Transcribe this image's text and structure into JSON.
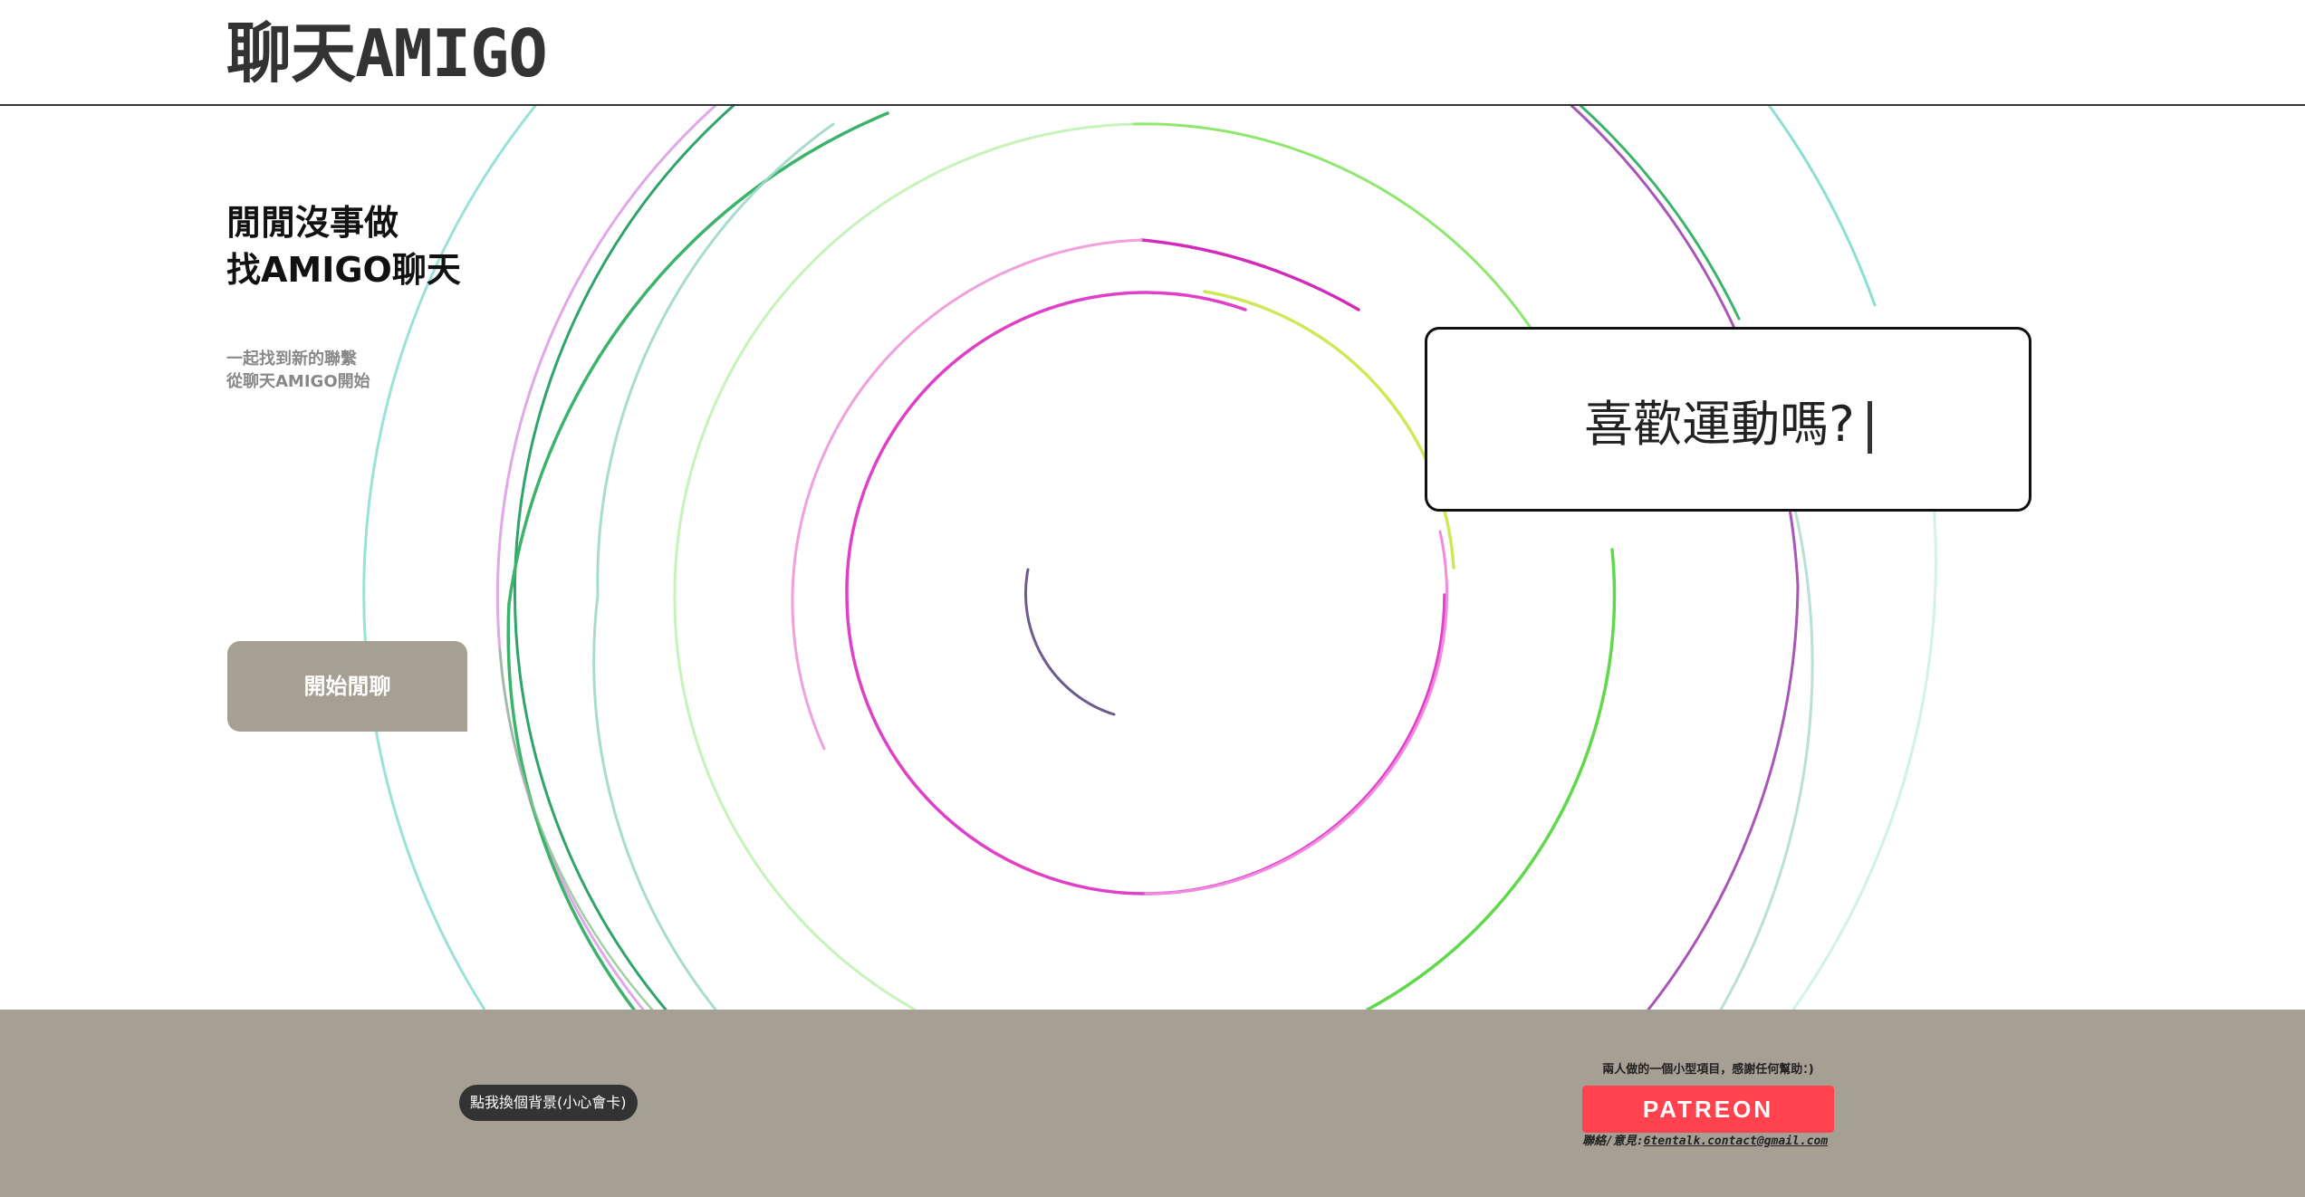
{
  "header": {
    "logo": "聊天AMIGO"
  },
  "hero": {
    "title_line1": "閒閒沒事做",
    "title_line2": "找AMIGO聊天",
    "subtitle_line1": "一起找到新的聯繫",
    "subtitle_line2": "從聊天AMIGO開始",
    "start_button": "開始閒聊"
  },
  "typing_box": {
    "text": "喜歡運動嗎?"
  },
  "footer": {
    "bg_switch_button": "點我換個背景(小心會卡)",
    "support_note": "兩人做的一個小型項目，感謝任何幫助：)",
    "patreon_button": "PATREON",
    "contact_label": "聯絡/意見:",
    "contact_email": "6tentalk.contact@gmail.com"
  },
  "colors": {
    "header_border": "#333333",
    "button_bg": "#a69f93",
    "footer_bg": "#a69f93",
    "switch_bg": "#333333",
    "patreon_red": "#ff424d",
    "ring_magenta": "#e040c8",
    "ring_green": "#3bb36a",
    "ring_lime": "#8ee870",
    "ring_teal": "#7fdccc",
    "ring_purple": "#9b4ab0"
  }
}
